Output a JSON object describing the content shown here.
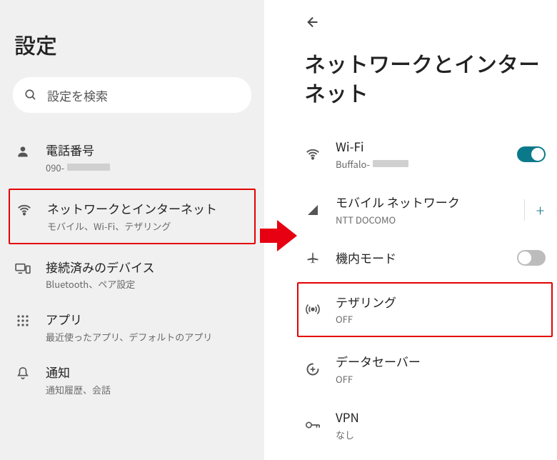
{
  "left": {
    "title": "設定",
    "search_placeholder": "設定を検索",
    "items": [
      {
        "icon": "person",
        "title": "電話番号",
        "sub_prefix": "090-"
      },
      {
        "icon": "wifi",
        "title": "ネットワークとインターネット",
        "sub": "モバイル、Wi-Fi、テザリング",
        "highlight": true
      },
      {
        "icon": "devices",
        "title": "接続済みのデバイス",
        "sub": "Bluetooth、ペア設定"
      },
      {
        "icon": "apps",
        "title": "アプリ",
        "sub": "最近使ったアプリ、デフォルトのアプリ"
      },
      {
        "icon": "bell",
        "title": "通知",
        "sub": "通知履歴、会話"
      }
    ]
  },
  "right": {
    "title": "ネットワークとインターネット",
    "items": [
      {
        "icon": "wifi",
        "title": "Wi-Fi",
        "sub_prefix": "Buffalo-",
        "switch": "on"
      },
      {
        "icon": "signal",
        "title": "モバイル ネットワーク",
        "sub": "NTT DOCOMO",
        "plus": true
      },
      {
        "icon": "airplane",
        "title": "機内モード",
        "switch": "off"
      },
      {
        "icon": "hotspot",
        "title": "テザリング",
        "sub": "OFF",
        "highlight": true
      },
      {
        "icon": "datasaver",
        "title": "データセーバー",
        "sub": "OFF"
      },
      {
        "icon": "vpn",
        "title": "VPN",
        "sub": "なし"
      }
    ]
  }
}
